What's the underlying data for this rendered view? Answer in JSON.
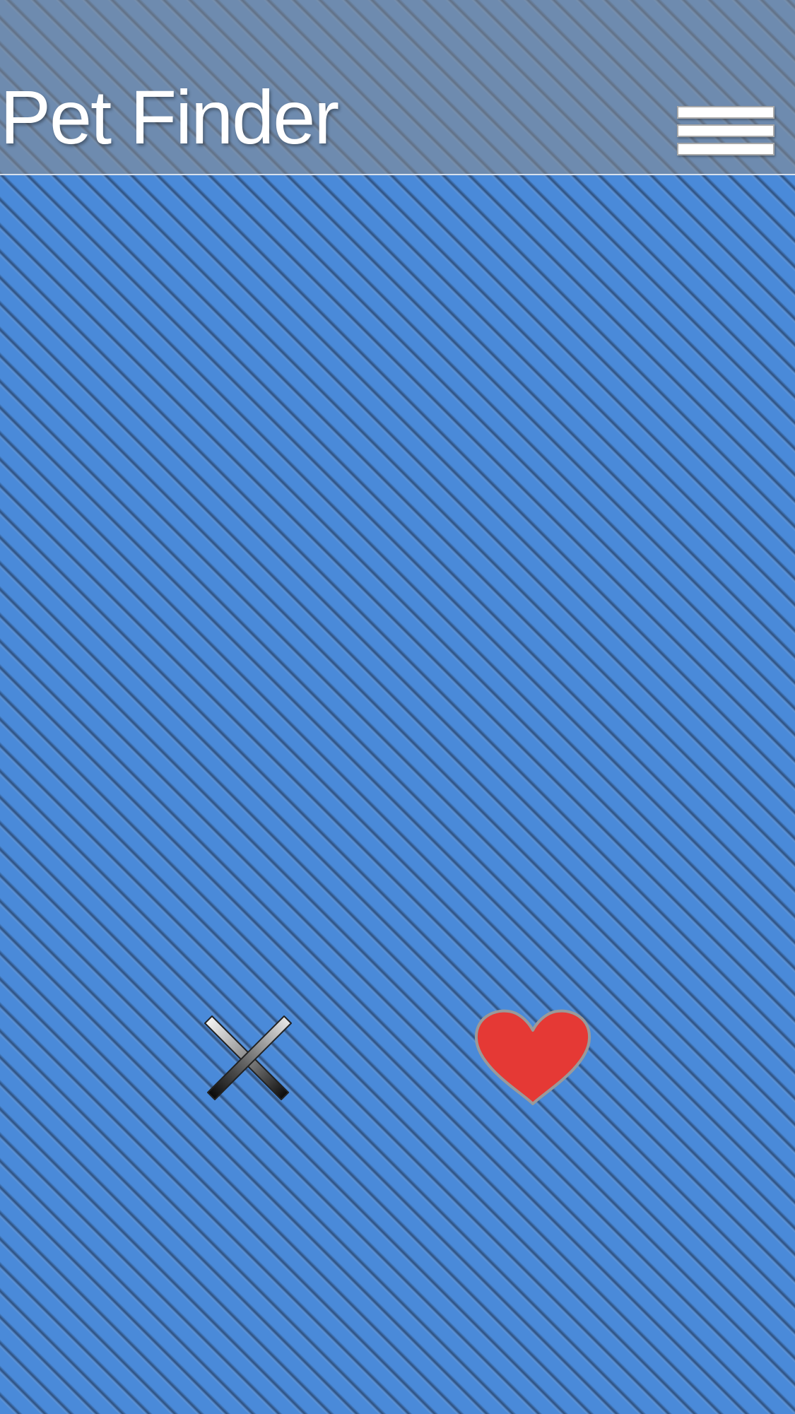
{
  "header": {
    "title": "Pet Finder",
    "menu_icon": "hamburger-menu-icon"
  },
  "actions": {
    "reject_icon": "close-x-icon",
    "like_icon": "heart-icon"
  },
  "colors": {
    "background": "#4a8ad9",
    "header_overlay": "#8c8c8c",
    "heart": "#e53935",
    "title_text": "#ffffff"
  }
}
